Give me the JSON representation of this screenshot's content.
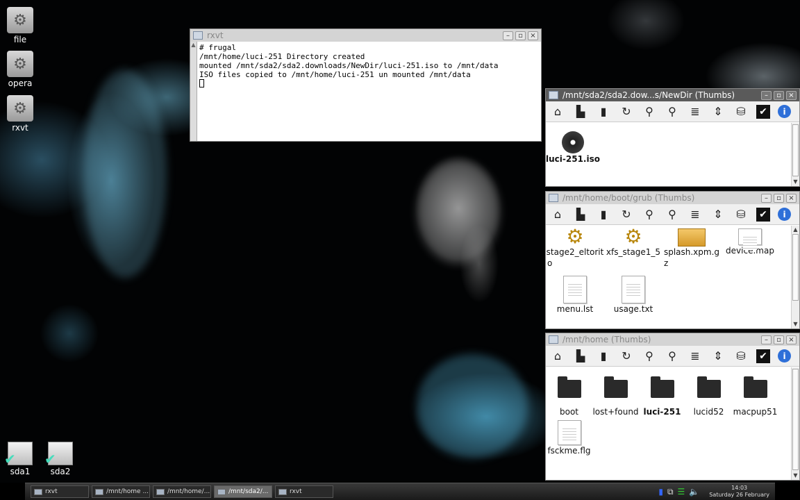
{
  "desktop": {
    "icons": [
      {
        "label": "file"
      },
      {
        "label": "opera"
      },
      {
        "label": "rxvt"
      }
    ],
    "drives": [
      {
        "label": "sda1"
      },
      {
        "label": "sda2"
      }
    ]
  },
  "terminal": {
    "title": "rxvt",
    "lines": [
      "# frugal",
      "/mnt/home/luci-251 Directory created",
      "mounted /mnt/sda2/sda2.downloads/NewDir/luci-251.iso to /mnt/data",
      "ISO files copied to /mnt/home/luci-251 un mounted /mnt/data"
    ]
  },
  "fm1": {
    "title": "/mnt/sda2/sda2.dow...s/NewDir (Thumbs)",
    "items": [
      {
        "label": "luci-251.iso"
      }
    ]
  },
  "fm2": {
    "title": "/mnt/home/boot/grub (Thumbs)",
    "items": [
      {
        "label1": "stage2_eltorit",
        "label2": "o"
      },
      {
        "label1": "xfs_stage1_5",
        "label2": ""
      },
      {
        "label1": "splash.xpm.g",
        "label2": "z"
      },
      {
        "label1": "device.map",
        "label2": ""
      },
      {
        "label1": "menu.lst",
        "label2": ""
      },
      {
        "label1": "usage.txt",
        "label2": ""
      }
    ]
  },
  "fm3": {
    "title": "/mnt/home (Thumbs)",
    "items": [
      {
        "label": "boot"
      },
      {
        "label": "lost+found"
      },
      {
        "label": "luci-251"
      },
      {
        "label": "lucid52"
      },
      {
        "label": "macpup51"
      },
      {
        "label": "fsckme.flg"
      }
    ]
  },
  "window_buttons": {
    "minimize": "–",
    "maximize": "▫",
    "close": "×"
  },
  "toolbar_icons": [
    "up-icon",
    "home-icon",
    "bookmark-icon",
    "refresh-icon",
    "zoom-in-icon",
    "zoom-out-icon",
    "list-view-icon",
    "sort-icon",
    "mount-icon",
    "select-icon",
    "info-icon"
  ],
  "taskbar": {
    "tasks": [
      {
        "label": "rxvt"
      },
      {
        "label": "/mnt/home ..."
      },
      {
        "label": "/mnt/home/..."
      },
      {
        "label": "/mnt/sda2/..."
      },
      {
        "label": "rxvt"
      }
    ],
    "clock_time": "14:03",
    "clock_date": "Saturday 26 February"
  }
}
